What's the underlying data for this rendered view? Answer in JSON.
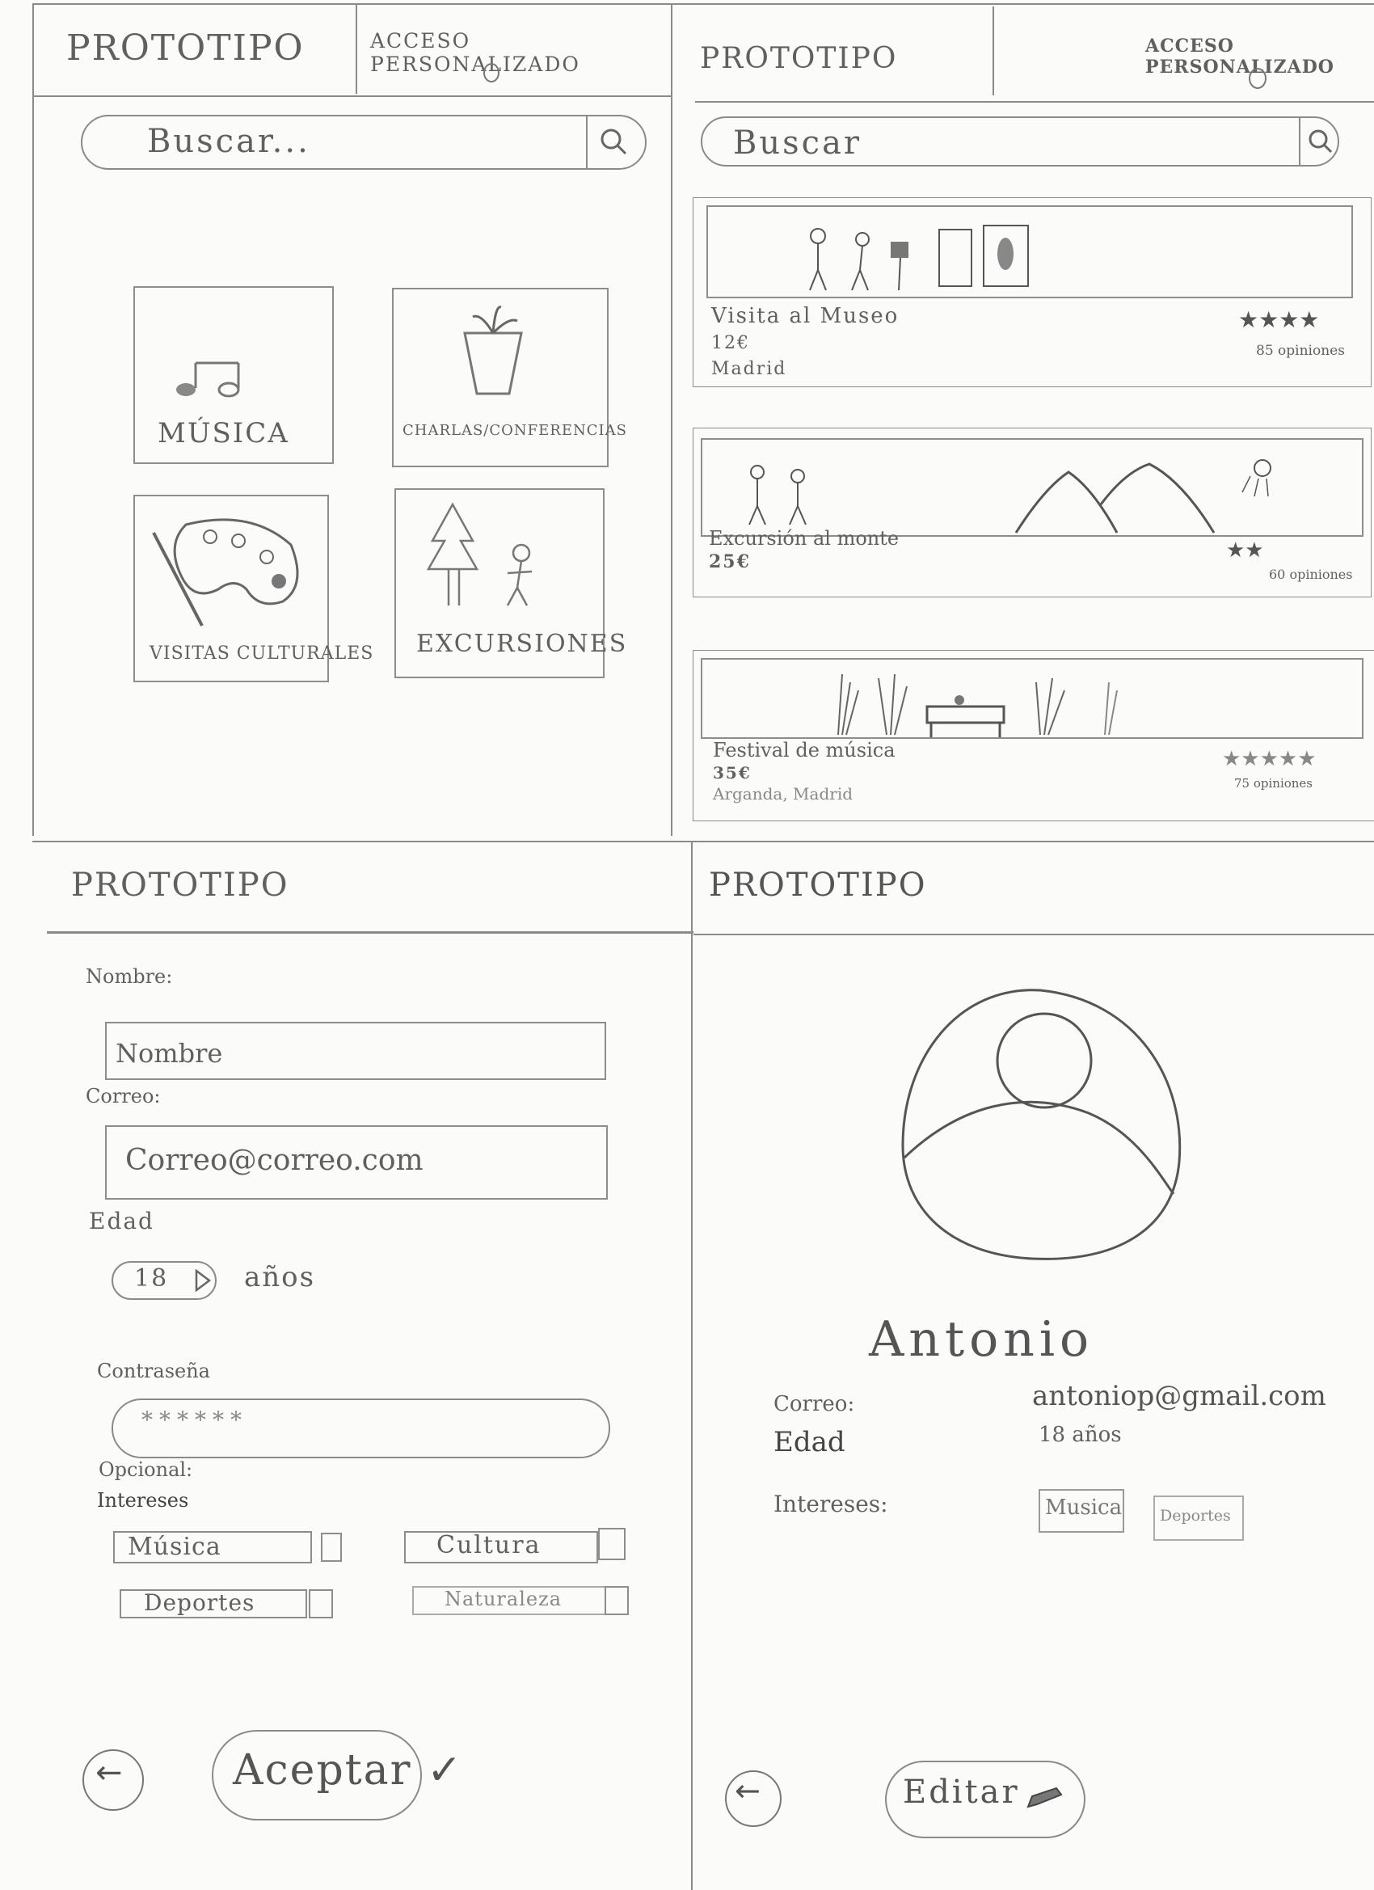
{
  "screen1": {
    "header_title": "PROTOTIPO",
    "header_access": "ACCESO PERSONALIZADO",
    "search_placeholder": "Buscar...",
    "categories": [
      {
        "label": "MÚSICA",
        "icon": "music-note-icon"
      },
      {
        "label": "CHARLAS/CONFERENCIAS",
        "icon": "plant-pot-icon"
      },
      {
        "label": "VISITAS CULTURALES",
        "icon": "paint-palette-icon"
      },
      {
        "label": "EXCURSIONES",
        "icon": "tree-person-icon"
      }
    ]
  },
  "screen2": {
    "header_title": "PROTOTIPO",
    "header_access": "ACCESO PERSONALIZADO",
    "search_placeholder": "Buscar",
    "results": [
      {
        "title": "Visita al Museo",
        "price": "12€",
        "location": "Madrid",
        "stars": "★★★★",
        "reviews": "85 opiniones",
        "image": "museum-visit-illustration"
      },
      {
        "title": "Excursión al monte",
        "price": "25€",
        "location": "",
        "stars": "★★",
        "reviews": "60 opiniones",
        "image": "mountain-hike-illustration"
      },
      {
        "title": "Festival de música",
        "price": "35€",
        "location": "Arganda, Madrid",
        "stars": "★★★★★",
        "reviews": "75 opiniones",
        "image": "music-festival-illustration"
      }
    ]
  },
  "screen3": {
    "header_title": "PROTOTIPO",
    "name_label": "Nombre:",
    "name_placeholder": "Nombre",
    "email_label": "Correo:",
    "email_placeholder": "Correo@correo.com",
    "age_label": "Edad",
    "age_value": "18",
    "age_unit": "años",
    "password_label": "Contraseña",
    "password_value": "******",
    "optional_label": "Opcional:",
    "interests_label": "Intereses",
    "interests": [
      "Música",
      "Cultura",
      "Deportes",
      "Naturaleza"
    ],
    "back_label": "←",
    "accept_label": "Aceptar ✓"
  },
  "screen4": {
    "header_title": "PROTOTIPO",
    "user_name": "Antonio",
    "email_label": "Correo:",
    "email_value": "antoniop@gmail.com",
    "age_label": "Edad",
    "age_value": "18 años",
    "interests_label": "Intereses:",
    "interests": [
      "Musica",
      "Deportes"
    ],
    "back_label": "←",
    "edit_label": "Editar"
  },
  "colors": {
    "paper": "#fbfbfa",
    "pencil": "#777777"
  }
}
